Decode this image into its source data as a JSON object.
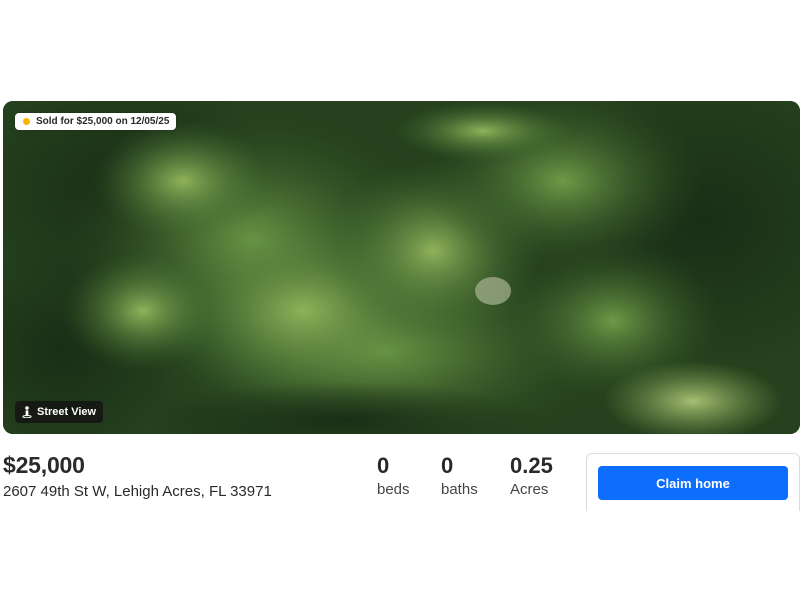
{
  "listing": {
    "sold_badge": "Sold for $25,000 on 12/05/25",
    "street_view_label": "Street View",
    "price": "$25,000",
    "address": "2607 49th St W, Lehigh Acres, FL 33971",
    "stats": [
      {
        "value": "0",
        "label": "beds"
      },
      {
        "value": "0",
        "label": "baths"
      },
      {
        "value": "0.25",
        "label": "Acres"
      }
    ],
    "claim_button": "Claim home"
  },
  "icons": {
    "sold_status": "dot-icon",
    "street_view": "pegman-icon"
  },
  "colors": {
    "sold_dot": "#f5b400",
    "claim_button": "#0d6efd",
    "text": "#2a2a2a"
  }
}
